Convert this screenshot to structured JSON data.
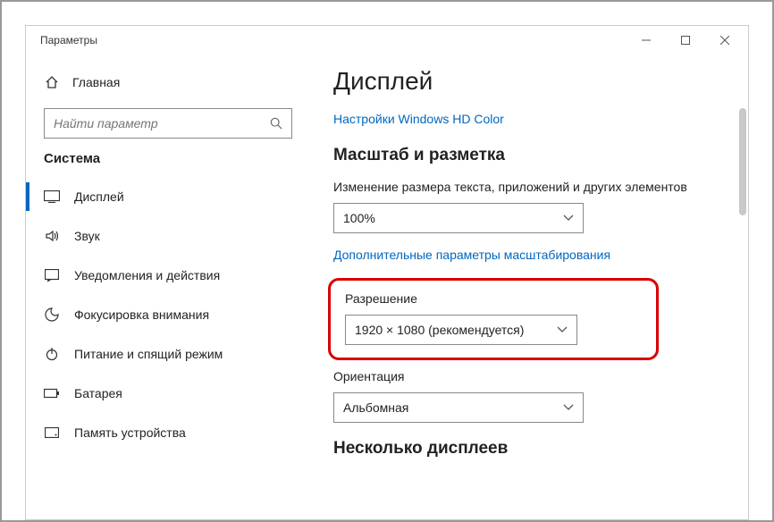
{
  "window": {
    "title": "Параметры"
  },
  "sidebar": {
    "home": "Главная",
    "search_placeholder": "Найти параметр",
    "section": "Система",
    "items": [
      {
        "label": "Дисплей"
      },
      {
        "label": "Звук"
      },
      {
        "label": "Уведомления и действия"
      },
      {
        "label": "Фокусировка внимания"
      },
      {
        "label": "Питание и спящий режим"
      },
      {
        "label": "Батарея"
      },
      {
        "label": "Память устройства"
      }
    ]
  },
  "content": {
    "title": "Дисплей",
    "hd_link": "Настройки Windows HD Color",
    "scale_heading": "Масштаб и разметка",
    "scale_label": "Изменение размера текста, приложений и других элементов",
    "scale_value": "100%",
    "adv_scale_link": "Дополнительные параметры масштабирования",
    "res_label": "Разрешение",
    "res_value": "1920 × 1080 (рекомендуется)",
    "orient_label": "Ориентация",
    "orient_value": "Альбомная",
    "multi_heading": "Несколько дисплеев"
  }
}
